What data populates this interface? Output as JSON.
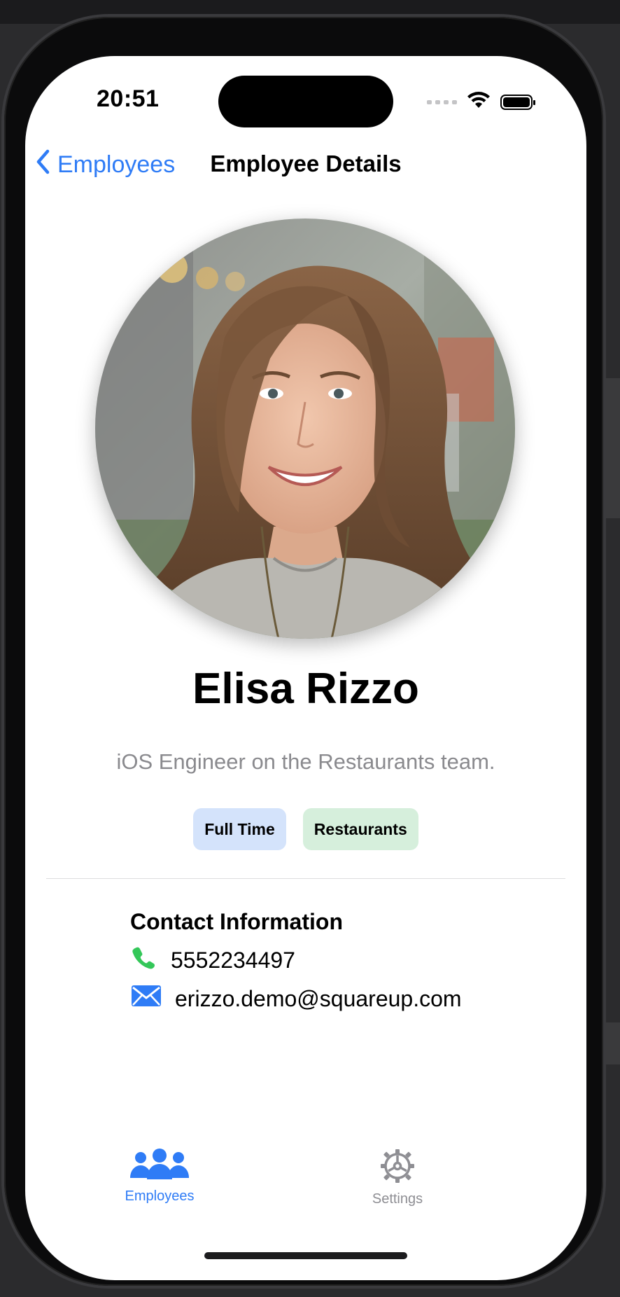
{
  "status_bar": {
    "time": "20:51"
  },
  "nav": {
    "back_label": "Employees",
    "title": "Employee Details"
  },
  "employee": {
    "name": "Elisa Rizzo",
    "bio": "iOS Engineer on the Restaurants team.",
    "tags": [
      "Full Time",
      "Restaurants"
    ]
  },
  "contact": {
    "heading": "Contact Information",
    "phone": "5552234497",
    "email": "erizzo.demo@squareup.com"
  },
  "tabbar": {
    "items": [
      {
        "label": "Employees",
        "icon": "people-icon",
        "selected": true
      },
      {
        "label": "Settings",
        "icon": "gear-icon",
        "selected": false
      }
    ]
  },
  "colors": {
    "accent": "#2f7cf6",
    "tag_full_time_bg": "#d4e3fb",
    "tag_team_bg": "#d6efdc",
    "phone_icon": "#34c759",
    "secondary_text": "#8a8a8e"
  }
}
